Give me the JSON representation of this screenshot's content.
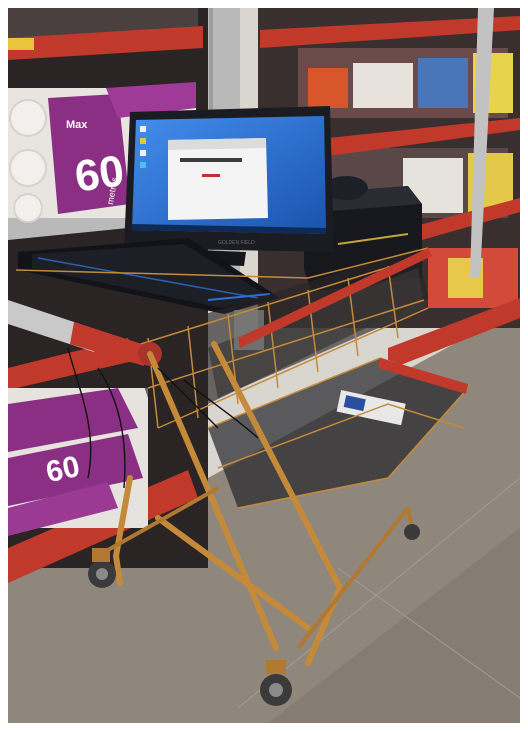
{
  "photo": {
    "scene": "supermarket-aisle",
    "colors": {
      "floor": "#8f877c",
      "shelf_red": "#c0392b",
      "shelf_metal": "#b9b9b9",
      "cart_frame": "#c48a3a",
      "cart_handle": "#c9c9c9",
      "monitor_bezel": "#1b1c22",
      "screen_blue": "#2a6fd6",
      "toilet_paper_pack": "#8b2f84"
    }
  },
  "packages": {
    "top_left_brand": "Max",
    "top_left_count": "60",
    "top_left_unit": "metros",
    "bottom_left_count": "60"
  },
  "monitor": {
    "brand": "GOLDEN FIELD"
  }
}
